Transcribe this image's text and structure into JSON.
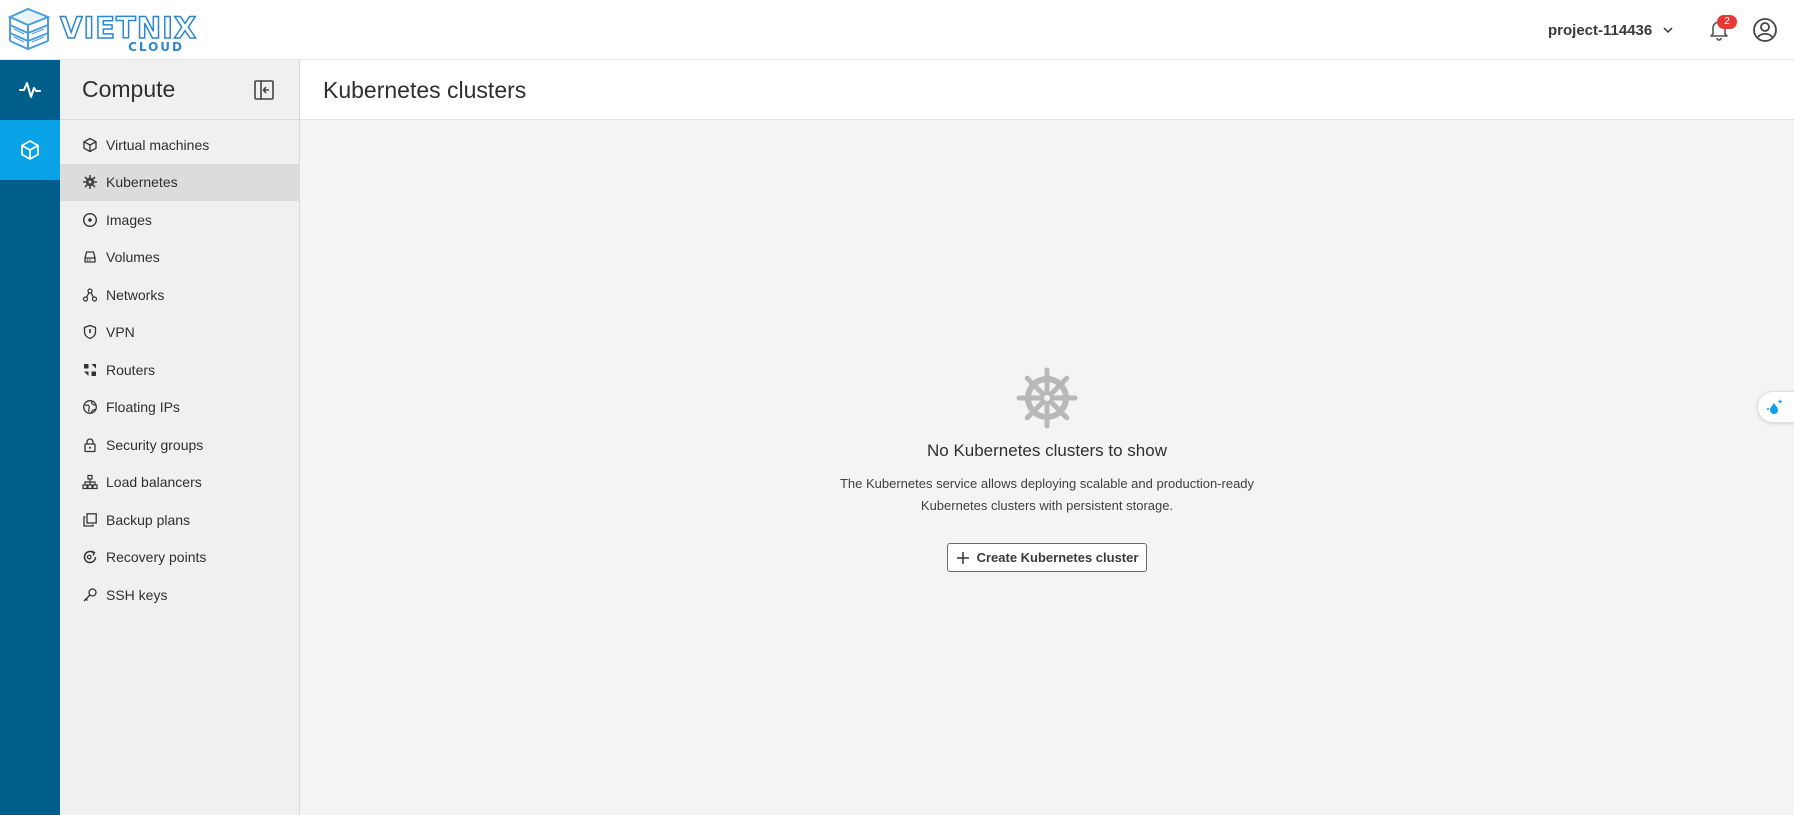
{
  "brand": {
    "name": "VIETNIX",
    "sub": "CLOUD",
    "color": "#2d87d0"
  },
  "header": {
    "project": "project-114436",
    "notifications": "2"
  },
  "rail": {
    "items": [
      {
        "icon": "pulse-icon"
      },
      {
        "icon": "cube-icon",
        "active": true
      }
    ],
    "colors": {
      "background": "#005f8a",
      "active": "#0aa2e6"
    }
  },
  "sidebar": {
    "title": "Compute",
    "items": [
      {
        "label": "Virtual machines",
        "icon": "cube-icon"
      },
      {
        "label": "Kubernetes",
        "icon": "helm-icon",
        "active": true
      },
      {
        "label": "Images",
        "icon": "disc-icon"
      },
      {
        "label": "Volumes",
        "icon": "hard-drive-icon"
      },
      {
        "label": "Networks",
        "icon": "network-icon"
      },
      {
        "label": "VPN",
        "icon": "shield-icon"
      },
      {
        "label": "Routers",
        "icon": "router-icon"
      },
      {
        "label": "Floating IPs",
        "icon": "globe-icon"
      },
      {
        "label": "Security groups",
        "icon": "lock-icon"
      },
      {
        "label": "Load balancers",
        "icon": "sitemap-icon"
      },
      {
        "label": "Backup plans",
        "icon": "copy-icon"
      },
      {
        "label": "Recovery points",
        "icon": "restore-icon"
      },
      {
        "label": "SSH keys",
        "icon": "key-icon"
      }
    ]
  },
  "main": {
    "title": "Kubernetes clusters",
    "empty": {
      "title": "No Kubernetes clusters to show",
      "desc_line1": "The Kubernetes service allows deploying scalable and production-ready",
      "desc_line2": "Kubernetes clusters with persistent storage.",
      "button": "Create Kubernetes cluster"
    }
  }
}
